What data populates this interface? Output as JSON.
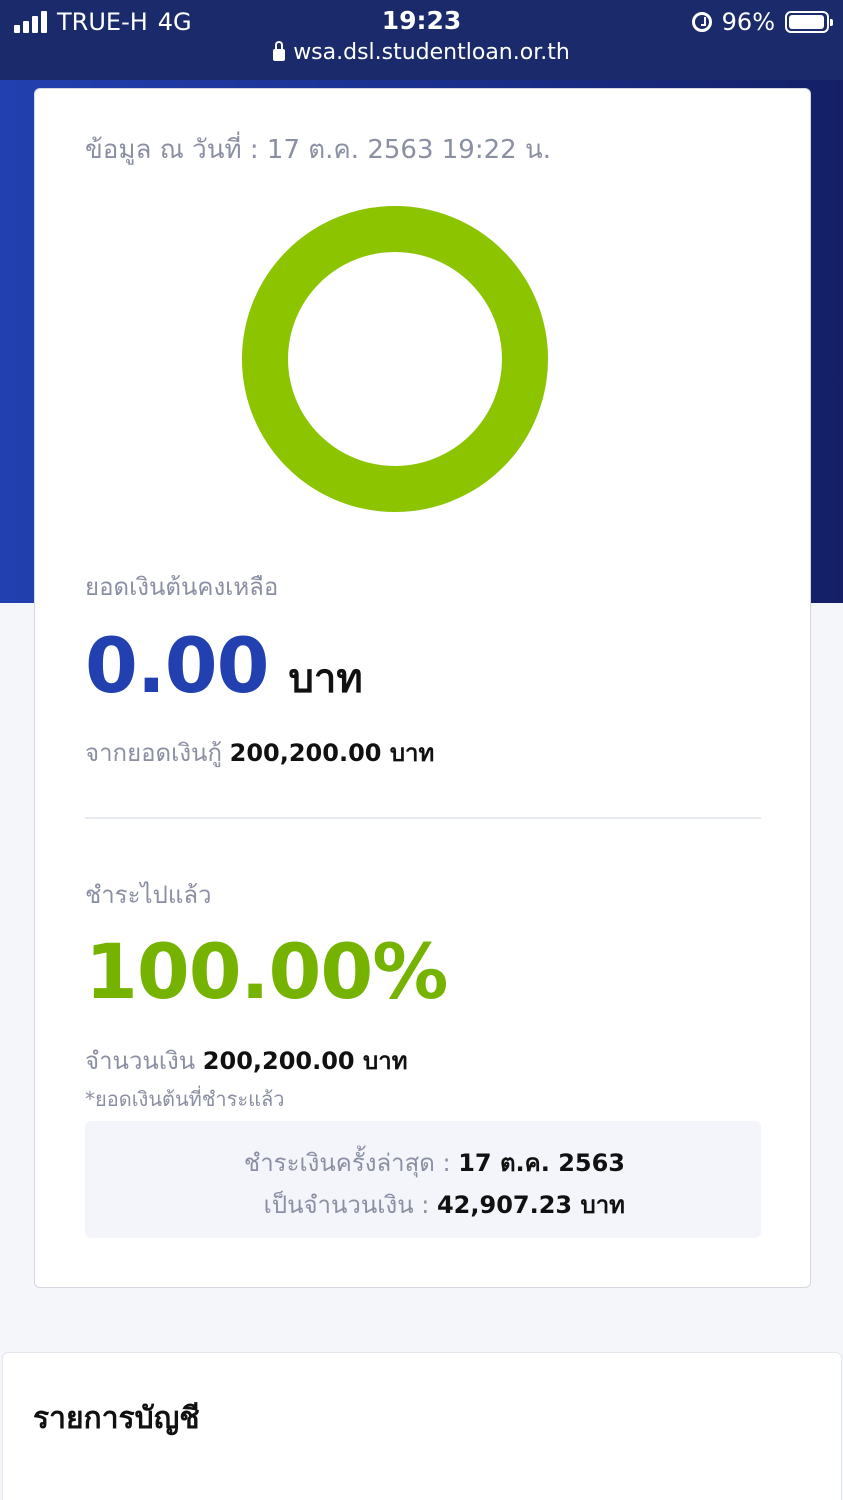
{
  "status_bar": {
    "carrier": "TRUE-H",
    "network": "4G",
    "time": "19:23",
    "battery": "96%",
    "battery_level": 0.96,
    "url": "wsa.dsl.studentloan.or.th"
  },
  "colors": {
    "header_bg": "#1b2a6b",
    "hero_blue": "#2340b0",
    "accent_green": "#8cc400",
    "paid_green": "#76b300"
  },
  "summary": {
    "as_of": "ข้อมูล ณ วันที่ : 17 ต.ค. 2563 19:22 น.",
    "donut_paid_fraction": 1.0,
    "remaining_label": "ยอดเงินต้นคงเหลือ",
    "remaining_value": "0.00",
    "remaining_unit": "บาท",
    "from_label": "จากยอดเงินกู้",
    "from_value": "200,200.00 บาท",
    "paid_label": "ชำระไปแล้ว",
    "paid_percent": "100.00%",
    "amount_label": "จำนวนเงิน",
    "amount_value": "200,200.00 บาท",
    "note": "*ยอดเงินต้นที่ชำระแล้ว",
    "last_payment_label": "ชำระเงินครั้งล่าสุด :",
    "last_payment_date": "17 ต.ค. 2563",
    "last_amount_label": "เป็นจำนวนเงิน :",
    "last_amount_value": "42,907.23 บาท"
  },
  "accounts": {
    "title": "รายการบัญชี"
  }
}
